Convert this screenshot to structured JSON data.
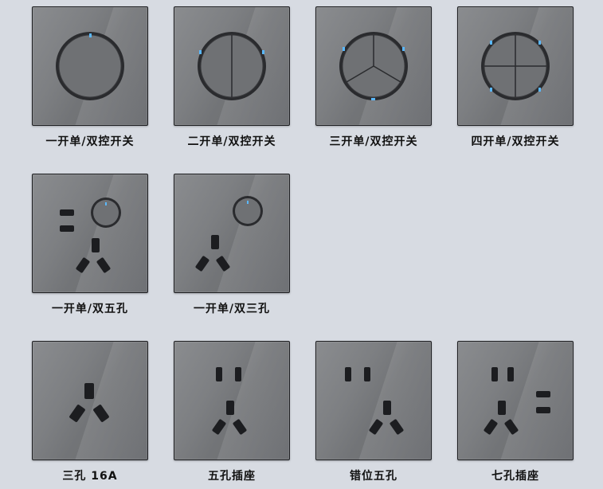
{
  "products": [
    {
      "label": "一开单/双控开关",
      "icon": "one-gang-switch-icon"
    },
    {
      "label": "二开单/双控开关",
      "icon": "two-gang-switch-icon"
    },
    {
      "label": "三开单/双控开关",
      "icon": "three-gang-switch-icon"
    },
    {
      "label": "四开单/双控开关",
      "icon": "four-gang-switch-icon"
    },
    {
      "label": "一开单/双五孔",
      "icon": "switch-five-hole-socket-icon"
    },
    {
      "label": "一开单/双三孔",
      "icon": "switch-three-hole-socket-icon"
    },
    {
      "label": "三孔 16A",
      "icon": "three-hole-16a-socket-icon"
    },
    {
      "label": "五孔插座",
      "icon": "five-hole-socket-icon"
    },
    {
      "label": "错位五孔",
      "icon": "offset-five-hole-socket-icon"
    },
    {
      "label": "七孔插座",
      "icon": "seven-hole-socket-icon"
    }
  ],
  "colors": {
    "background": "#d7dbe2",
    "panel": "#7d7f82",
    "indicator": "#5ab8ff"
  }
}
